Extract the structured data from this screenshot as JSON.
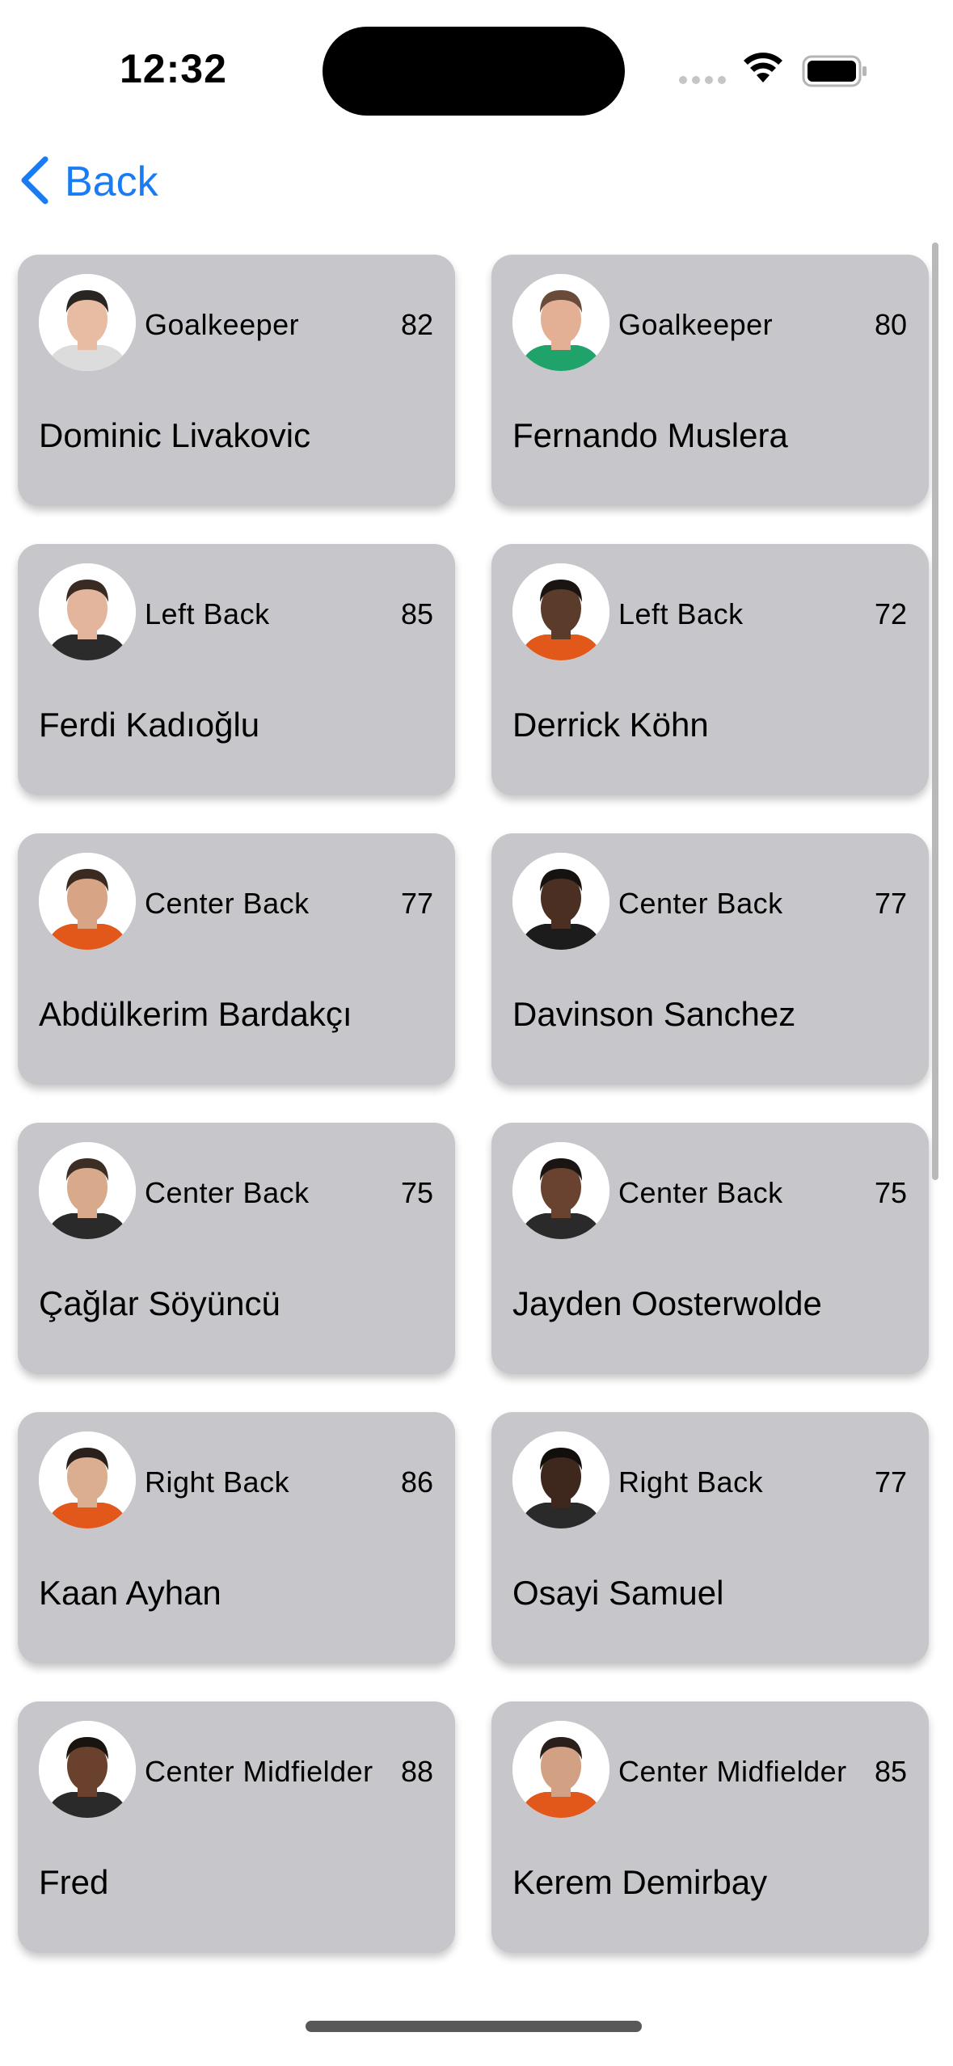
{
  "status_bar": {
    "time": "12:32"
  },
  "nav": {
    "back_label": "Back"
  },
  "players": [
    {
      "position": "Goalkeeper",
      "rating": "82",
      "name": "Dominic Livakovic",
      "skin": "#e8bba3",
      "hair": "#2a2522",
      "shirt": "#dcdcdc"
    },
    {
      "position": "Goalkeeper",
      "rating": "80",
      "name": "Fernando Muslera",
      "skin": "#e3b095",
      "hair": "#6a4a38",
      "shirt": "#1fa36a"
    },
    {
      "position": "Left Back",
      "rating": "85",
      "name": "Ferdi Kadıoğlu",
      "skin": "#e2b59c",
      "hair": "#3a2a22",
      "shirt": "#2b2b2b"
    },
    {
      "position": "Left Back",
      "rating": "72",
      "name": "Derrick Köhn",
      "skin": "#5b3b2a",
      "hair": "#1b1512",
      "shirt": "#e2581b"
    },
    {
      "position": "Center Back",
      "rating": "77",
      "name": "Abdülkerim Bardakçı",
      "skin": "#d7a486",
      "hair": "#3a2a20",
      "shirt": "#e2581b"
    },
    {
      "position": "Center Back",
      "rating": "77",
      "name": "Davinson Sanchez",
      "skin": "#4a2f22",
      "hair": "#161210",
      "shirt": "#1c1c1c"
    },
    {
      "position": "Center Back",
      "rating": "75",
      "name": "Çağlar Söyüncü",
      "skin": "#d9a98c",
      "hair": "#3d2e25",
      "shirt": "#2a2a2a"
    },
    {
      "position": "Center Back",
      "rating": "75",
      "name": "Jayden Oosterwolde",
      "skin": "#6a4330",
      "hair": "#1a1412",
      "shirt": "#2a2a2a"
    },
    {
      "position": "Right Back",
      "rating": "86",
      "name": "Kaan Ayhan",
      "skin": "#dcae90",
      "hair": "#2b211c",
      "shirt": "#e2581b"
    },
    {
      "position": "Right Back",
      "rating": "77",
      "name": "Osayi Samuel",
      "skin": "#3e281d",
      "hair": "#120e0c",
      "shirt": "#2a2a2a"
    },
    {
      "position": "Center Midfielder",
      "rating": "88",
      "name": "Fred",
      "skin": "#6a412c",
      "hair": "#1a1411",
      "shirt": "#2a2a2a"
    },
    {
      "position": "Center Midfielder",
      "rating": "85",
      "name": "Kerem Demirbay",
      "skin": "#d2a083",
      "hair": "#2a201b",
      "shirt": "#e2581b"
    }
  ]
}
